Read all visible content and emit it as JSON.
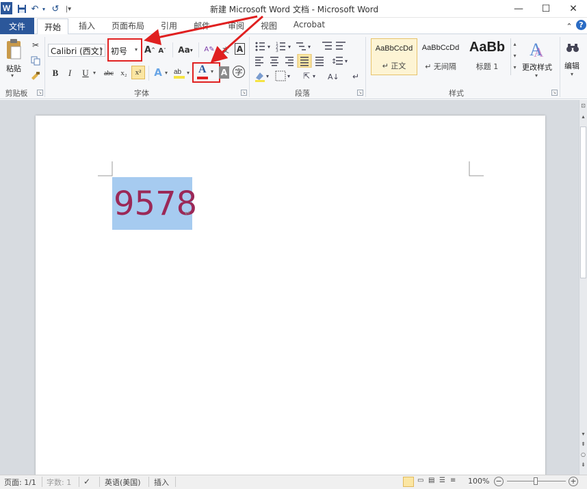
{
  "window": {
    "title": "新建 Microsoft Word 文档 - Microsoft Word",
    "logo_letter": "W",
    "minimize_glyph": "—",
    "maximize_glyph": "☐",
    "close_glyph": "✕"
  },
  "quick_access": {
    "save_icon": "save-icon",
    "undo_glyph": "↶",
    "redo_glyph": "↺",
    "customize_glyph": "|▾"
  },
  "tabs": {
    "file": "文件",
    "home": "开始",
    "insert": "插入",
    "layout": "页面布局",
    "references": "引用",
    "mailings": "邮件",
    "review": "审阅",
    "view": "视图",
    "acrobat": "Acrobat"
  },
  "ribbon_right": {
    "collapse_glyph": "⌃",
    "help_glyph": "?"
  },
  "clipboard": {
    "paste_label": "粘贴",
    "group_label": "剪贴板"
  },
  "font": {
    "font_name": "Calibri (西文]",
    "font_size": "初号",
    "grow_label": "A",
    "shrink_label": "A",
    "case_label": "Aa",
    "bold": "B",
    "italic": "I",
    "underline": "U",
    "strikethrough": "abc",
    "subscript": "x₂",
    "superscript": "x²",
    "font_color_letter": "A",
    "shade_letter": "A",
    "char_border_letter": "A",
    "enclose_glyph": "字",
    "group_label": "字体",
    "font_color": "#e02020",
    "highlight_color": "#f5e342"
  },
  "paragraph": {
    "group_label": "段落"
  },
  "styles": {
    "items": [
      {
        "sample": "AaBbCcDd",
        "name": "↵ 正文"
      },
      {
        "sample": "AaBbCcDd",
        "name": "↵ 无间隔"
      },
      {
        "sample": "AaBb",
        "name": "标题 1"
      }
    ],
    "change_styles_label": "更改样式",
    "group_label": "样式"
  },
  "editing": {
    "label": "编辑",
    "icon": "binoculars-icon"
  },
  "document": {
    "text": "9578",
    "paragraph_mark": "↵",
    "text_color": "#9b2857",
    "selection_color": "#a6cbf0"
  },
  "status": {
    "page": "页面: 1/1",
    "words": "字数: 1",
    "language": "英语(美国)",
    "insert_mode": "插入",
    "zoom": "100%",
    "zoom_out": "−",
    "zoom_in": "+"
  }
}
